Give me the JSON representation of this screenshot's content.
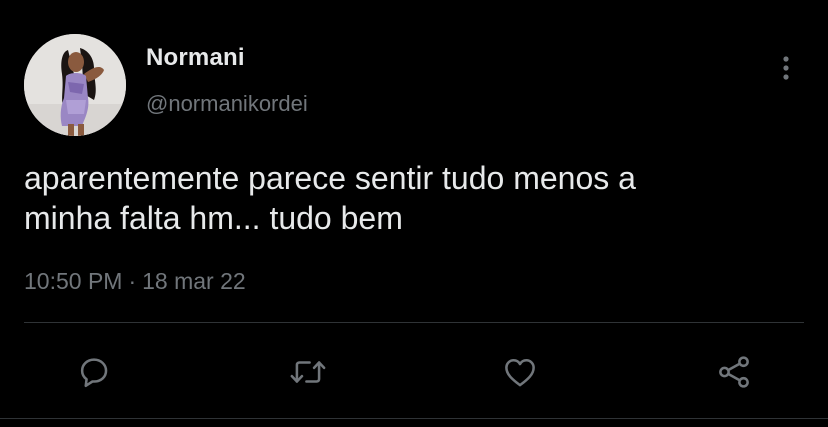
{
  "author": {
    "name": "Normani",
    "handle": "@normanikordei"
  },
  "tweet": {
    "text_line1": "aparentemente parece sentir tudo menos a",
    "text_line2": "minha falta hm... tudo bem",
    "time": "10:50 PM",
    "separator": "·",
    "date": "18 mar 22"
  },
  "actions": [
    "reply-icon",
    "retweet-icon",
    "like-icon",
    "share-icon"
  ],
  "colors": {
    "background": "#000000",
    "primary_text": "#e7e9ea",
    "secondary_text": "#71767b",
    "divider": "#2f3336"
  }
}
